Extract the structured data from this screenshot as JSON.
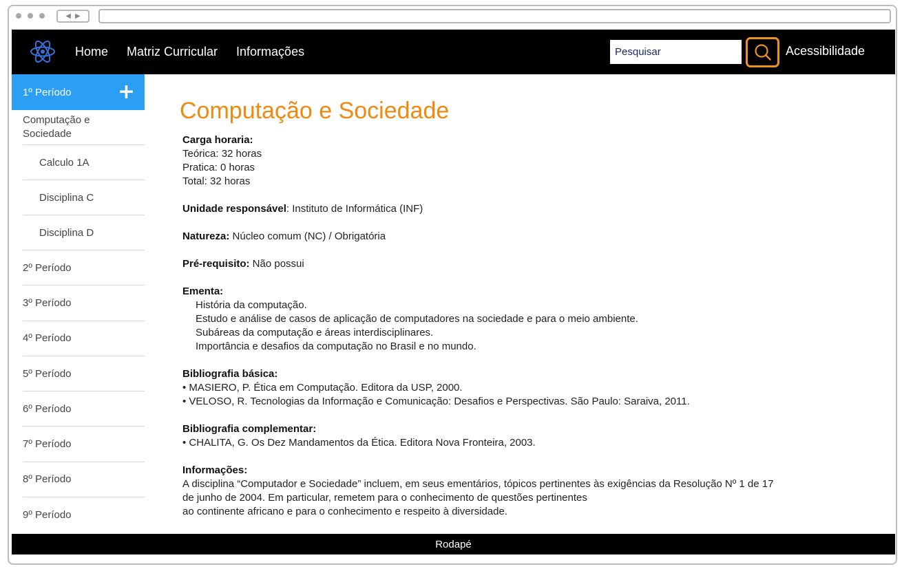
{
  "nav": {
    "items": [
      "Home",
      "Matriz Curricular",
      "Informações"
    ],
    "search_placeholder": "Pesquisar",
    "accessibility": "Acessibilidade"
  },
  "colors": {
    "accent": "#f0890f",
    "active": "#2a9ff3",
    "bar": "#000000"
  },
  "sidebar": {
    "active_period": "1º Período",
    "active_icon": "plus-icon",
    "subitems": [
      "Computação e Sociedade",
      "Calculo 1A",
      "Disciplina C",
      "Disciplina D"
    ],
    "periods": [
      "2º Período",
      "3º Período",
      "4º Período",
      "5º Período",
      "6º Período",
      "7º Período",
      "8º Período",
      "9º Período"
    ]
  },
  "course": {
    "title": "Computação e Sociedade",
    "carga_label": "Carga horaria:",
    "carga_lines": [
      "Teórica: 32 horas",
      "Pratica: 0 horas",
      "Total: 32 horas"
    ],
    "unidade_label": "Unidade responsável",
    "unidade_value": ": Instituto de Informática (INF)",
    "natureza_label": "Natureza:",
    "natureza_value": " Núcleo comum (NC) / Obrigatória",
    "prereq_label": "Pré-requisito:",
    "prereq_value": " Não possui",
    "ementa_label": "Ementa:",
    "ementa_lines": [
      "História da computação.",
      "Estudo e análise de casos de aplicação de computadores na sociedade e para o meio ambiente.",
      "Subáreas da computação e áreas interdisciplinares.",
      "Importância e desafios da computação no Brasil e no mundo."
    ],
    "biblio_basica_label": "Bibliografia básica:",
    "biblio_basica": [
      "• MASIERO, P. Ética em Computação. Editora da USP, 2000.",
      "• VELOSO, R. Tecnologias da Informação e Comunicação: Desafios e Perspectivas. São Paulo: Saraiva, 2011."
    ],
    "biblio_comp_label": "Bibliografia complementar:",
    "biblio_comp": [
      "• CHALITA, G. Os Dez Mandamentos da Ética. Editora Nova Fronteira, 2003."
    ],
    "info_label": "Informações:",
    "info_lines": [
      "A disciplina “Computador e Sociedade” incluem, em seus ementários, tópicos pertinentes às exigências da Resolução Nº 1 de 17",
      "de junho de 2004. Em particular, remetem para o conhecimento de questões pertinentes",
      "ao continente africano e para o conhecimento e respeito à diversidade."
    ]
  },
  "footer": {
    "text": "Rodapé"
  }
}
